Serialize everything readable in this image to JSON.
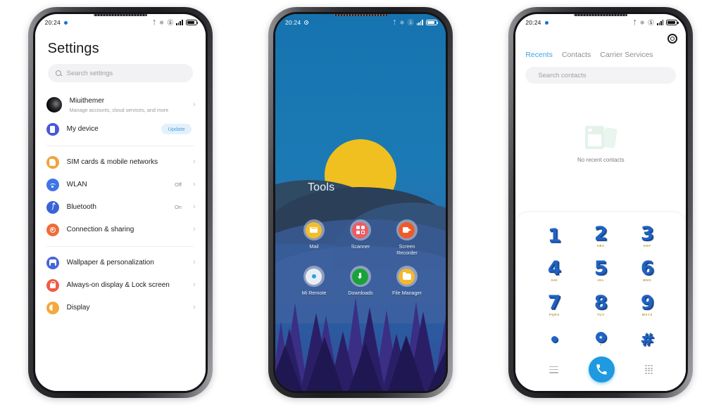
{
  "status_bar": {
    "time": "20:24",
    "icons": [
      "bluetooth-icon",
      "vpn-off-icon",
      "dnd-icon",
      "signal-icon",
      "battery-icon"
    ]
  },
  "phone1_settings": {
    "title": "Settings",
    "search": {
      "placeholder": "Search settings",
      "icon": "search-icon"
    },
    "account": {
      "name": "Miuithemer",
      "subtitle": "Manage accounts, cloud services, and more",
      "avatar": "avatar"
    },
    "items": [
      {
        "label": "My device",
        "badge": "Update",
        "icon": "phone-icon",
        "color": "#4a57d8",
        "glyph": "g-phone"
      },
      {
        "label": "SIM cards & mobile networks",
        "value": "",
        "icon": "sim-card-icon",
        "color": "#f0a33c",
        "glyph": "g-sim"
      },
      {
        "label": "WLAN",
        "value": "Off",
        "icon": "wifi-icon",
        "color": "#3f74e8",
        "glyph": "g-wifi"
      },
      {
        "label": "Bluetooth",
        "value": "On",
        "icon": "bluetooth-icon",
        "color": "#3a63d8",
        "glyph": "g-bt"
      },
      {
        "label": "Connection & sharing",
        "value": "",
        "icon": "share-icon",
        "color": "#ef6b3a",
        "glyph": "g-share"
      },
      {
        "label": "Wallpaper & personalization",
        "value": "",
        "icon": "wallpaper-icon",
        "color": "#4466d8",
        "glyph": "g-wall"
      },
      {
        "label": "Always-on display & Lock screen",
        "value": "",
        "icon": "lock-icon",
        "color": "#ef5b46",
        "glyph": "g-lock"
      },
      {
        "label": "Display",
        "value": "",
        "icon": "display-icon",
        "color": "#f3a93c",
        "glyph": "g-disp"
      }
    ],
    "chevron": "›"
  },
  "phone2_home": {
    "folder_title": "Tools",
    "apps": [
      {
        "name": "Mail",
        "icon": "mail-icon",
        "color": "#f3be2c",
        "glyph": "i-mail"
      },
      {
        "name": "Scanner",
        "icon": "scanner-icon",
        "color": "#ee5b63",
        "glyph": "i-scan"
      },
      {
        "name": "Screen Recorder",
        "icon": "screen-recorder-icon",
        "color": "#ef5a2a",
        "glyph": "i-cam"
      },
      {
        "name": "Mi Remote",
        "icon": "mi-remote-icon",
        "color": "#e9eef6",
        "glyph": "i-remote"
      },
      {
        "name": "Downloads",
        "icon": "downloads-icon",
        "color": "#18a338",
        "glyph": "i-dl"
      },
      {
        "name": "File Manager",
        "icon": "file-manager-icon",
        "color": "#f4b82a",
        "glyph": "i-folder"
      }
    ],
    "wallpaper": {
      "sky_color": "#1673af",
      "sun_color": "#f0c020",
      "forest_color": "#2a1f66"
    }
  },
  "phone3_dialer": {
    "settings_icon": "gear-icon",
    "tabs": [
      {
        "label": "Recents",
        "active": true
      },
      {
        "label": "Contacts",
        "active": false
      },
      {
        "label": "Carrier Services",
        "active": false
      }
    ],
    "search": {
      "placeholder": "Search contacts",
      "icon": "search-icon"
    },
    "empty_state": {
      "text": "No recent contacts",
      "icon": "empty-contacts-icon"
    },
    "keys": [
      {
        "num": "1",
        "sub": ""
      },
      {
        "num": "2",
        "sub": "ABC"
      },
      {
        "num": "3",
        "sub": "DEF"
      },
      {
        "num": "4",
        "sub": "GHI"
      },
      {
        "num": "5",
        "sub": "JKL"
      },
      {
        "num": "6",
        "sub": "MNO"
      },
      {
        "num": "7",
        "sub": "PQRS"
      },
      {
        "num": "8",
        "sub": "TUV"
      },
      {
        "num": "9",
        "sub": "WXYZ"
      },
      {
        "num": "*",
        "sub": ""
      },
      {
        "num": "0",
        "sub": "+"
      },
      {
        "num": "#",
        "sub": ""
      }
    ],
    "bottom": {
      "menu_icon": "menu-icon",
      "call_icon": "call-icon",
      "keypad_icon": "keypad-icon"
    },
    "accent_color": "#1f9ae0",
    "key_color": "#1f63c4"
  }
}
